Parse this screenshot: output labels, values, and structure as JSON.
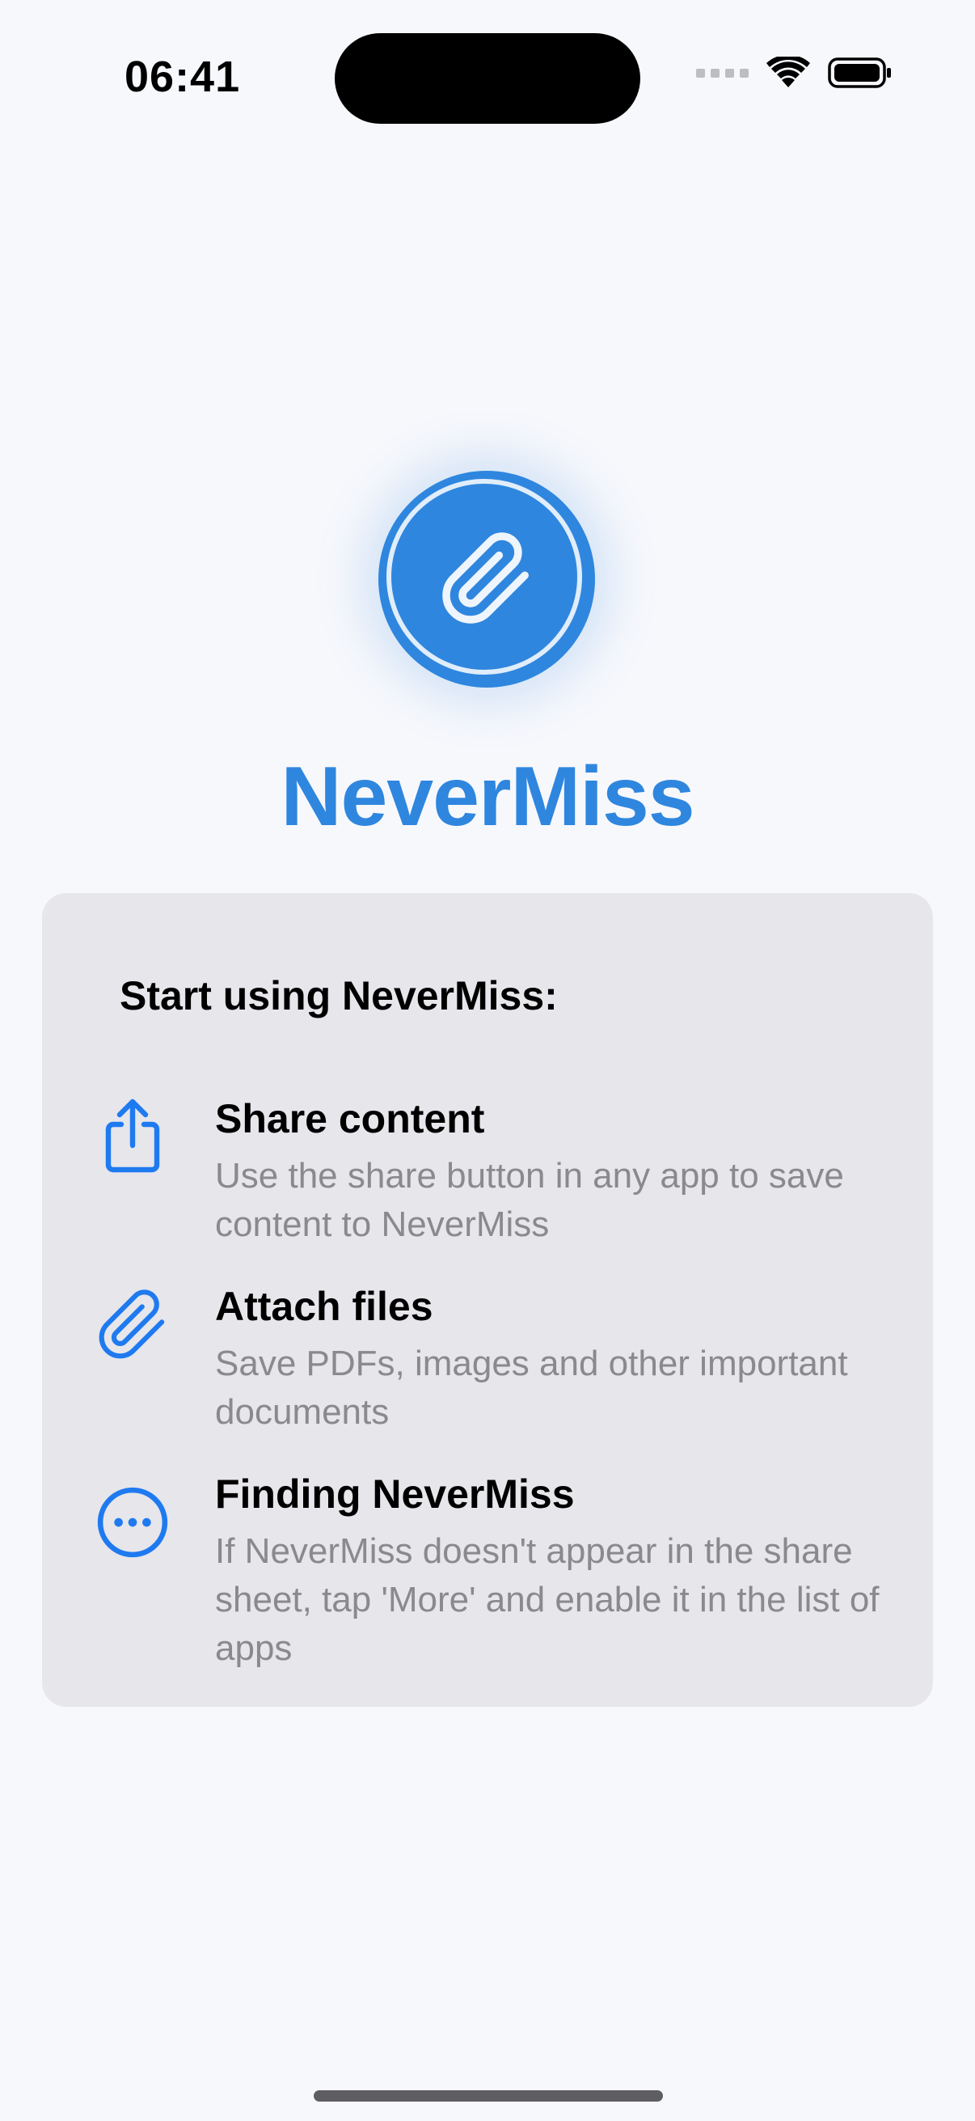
{
  "status_bar": {
    "time": "06:41"
  },
  "app": {
    "name": "NeverMiss",
    "accent_color": "#2F86DE",
    "logo_icon": "paperclip-icon"
  },
  "card": {
    "heading": "Start using NeverMiss:",
    "items": [
      {
        "icon": "share-icon",
        "title": "Share content",
        "description": "Use the share button in any app to save content to NeverMiss"
      },
      {
        "icon": "paperclip-icon",
        "title": "Attach files",
        "description": "Save PDFs, images and other important documents"
      },
      {
        "icon": "more-icon",
        "title": "Finding NeverMiss",
        "description": "If NeverMiss doesn't appear in the share sheet, tap 'More' and enable it in the list of apps"
      }
    ]
  }
}
